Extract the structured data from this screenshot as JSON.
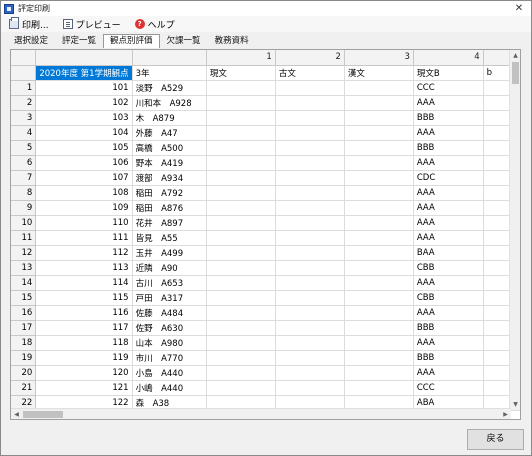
{
  "window": {
    "title": "評定印刷",
    "close_glyph": "✕"
  },
  "menu": [
    {
      "label": "印刷...",
      "icon": "printer-icon"
    },
    {
      "label": "プレビュー",
      "icon": "preview-icon"
    },
    {
      "label": "ヘルプ",
      "icon": "help-icon"
    }
  ],
  "tabs": [
    {
      "label": "選択設定",
      "active": false
    },
    {
      "label": "評定一覧",
      "active": false
    },
    {
      "label": "観点別評価",
      "active": true
    },
    {
      "label": "欠課一覧",
      "active": false
    },
    {
      "label": "教務資料",
      "active": false
    }
  ],
  "grid": {
    "col_numbers": [
      "",
      "",
      "1",
      "2",
      "3",
      "4",
      ""
    ],
    "header": [
      "2020年度 第1学期観点",
      "3年",
      "現文",
      "古文",
      "漢文",
      "現文B",
      "b"
    ],
    "rows": [
      {
        "rn": "1",
        "no": "101",
        "name": "淡野　A529",
        "val": "CCC"
      },
      {
        "rn": "2",
        "no": "102",
        "name": "川和本　A928",
        "val": "AAA"
      },
      {
        "rn": "3",
        "no": "103",
        "name": "木　A879",
        "val": "BBB"
      },
      {
        "rn": "4",
        "no": "104",
        "name": "外藤　A47",
        "val": "AAA"
      },
      {
        "rn": "5",
        "no": "105",
        "name": "高橋　A500",
        "val": "BBB"
      },
      {
        "rn": "6",
        "no": "106",
        "name": "野本　A419",
        "val": "AAA"
      },
      {
        "rn": "7",
        "no": "107",
        "name": "渡部　A934",
        "val": "CDC"
      },
      {
        "rn": "8",
        "no": "108",
        "name": "稲田　A792",
        "val": "AAA"
      },
      {
        "rn": "9",
        "no": "109",
        "name": "稲田　A876",
        "val": "AAA"
      },
      {
        "rn": "10",
        "no": "110",
        "name": "花井　A897",
        "val": "AAA"
      },
      {
        "rn": "11",
        "no": "111",
        "name": "皆見　A55",
        "val": "AAA"
      },
      {
        "rn": "12",
        "no": "112",
        "name": "玉井　A499",
        "val": "BAA"
      },
      {
        "rn": "13",
        "no": "113",
        "name": "近隣　A90",
        "val": "CBB"
      },
      {
        "rn": "14",
        "no": "114",
        "name": "古川　A653",
        "val": "AAA"
      },
      {
        "rn": "15",
        "no": "115",
        "name": "戸田　A317",
        "val": "CBB"
      },
      {
        "rn": "16",
        "no": "116",
        "name": "佐藤　A484",
        "val": "AAA"
      },
      {
        "rn": "17",
        "no": "117",
        "name": "佐野　A630",
        "val": "BBB"
      },
      {
        "rn": "18",
        "no": "118",
        "name": "山本　A980",
        "val": "AAA"
      },
      {
        "rn": "19",
        "no": "119",
        "name": "市川　A770",
        "val": "BBB"
      },
      {
        "rn": "20",
        "no": "120",
        "name": "小島　A440",
        "val": "AAA"
      },
      {
        "rn": "21",
        "no": "121",
        "name": "小嶋　A440",
        "val": "CCC"
      },
      {
        "rn": "22",
        "no": "122",
        "name": "森　A38",
        "val": "ABA"
      }
    ]
  },
  "scroll": {
    "up": "▲",
    "down": "▼",
    "left": "◀",
    "right": "▶"
  },
  "footer": {
    "back_label": "戻る"
  }
}
